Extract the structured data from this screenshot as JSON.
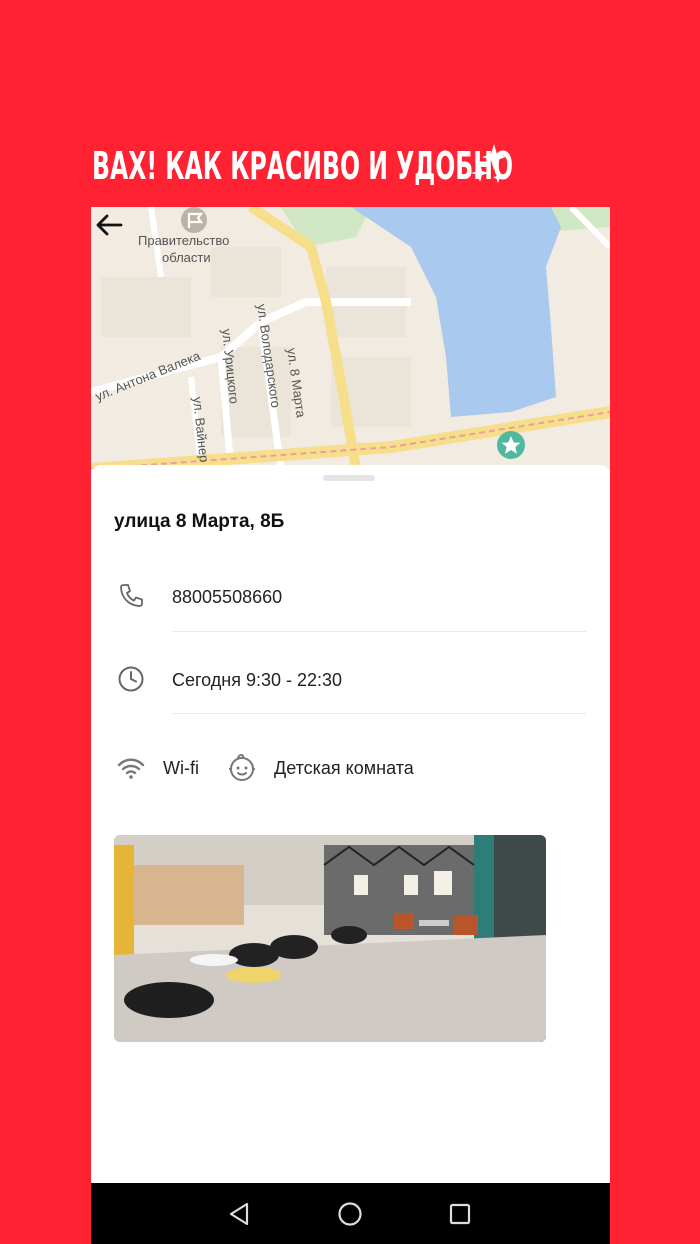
{
  "promo": {
    "headline": "ВАХ! КАК КРАСИВО И УДОБНО"
  },
  "colors": {
    "background": "#ff2232",
    "map_water": "#aac9ee",
    "map_road": "#f6de8b",
    "map_park": "#cfe7c3",
    "poi_accent": "#4fb89f"
  },
  "map": {
    "labels": {
      "government": "Правительство",
      "government2": "области",
      "street_8marta": "ул. 8 Марта",
      "street_volodarskogo": "ул. Володарского",
      "street_uritskogo": "ул. Урицкого",
      "street_valeka": "ул. Антона Валека",
      "street_vainera": "ул. Вайнер"
    }
  },
  "venue": {
    "address": "улица 8 Марта, 8Б",
    "phone": "88005508660",
    "hours": "Сегодня 9:30 - 22:30",
    "features": [
      {
        "icon": "wifi-icon",
        "label": "Wi-fi"
      },
      {
        "icon": "kid-face-icon",
        "label": "Детская комната"
      }
    ]
  }
}
